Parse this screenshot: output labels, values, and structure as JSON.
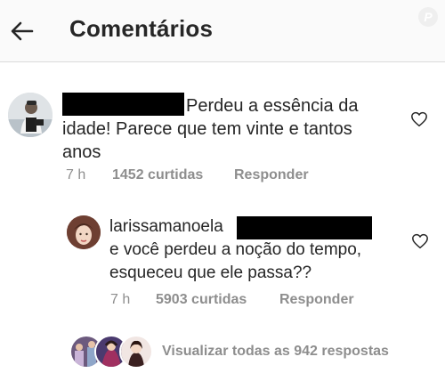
{
  "header": {
    "title": "Comentários",
    "back_icon": "arrow-left-icon",
    "watermark": "P"
  },
  "comment": {
    "text_line1": "Perdeu a essência da",
    "text_line2": "idade! Parece que tem vinte e tantos",
    "text_line3": "anos",
    "time": "7 h",
    "likes": "1452 curtidas",
    "reply_label": "Responder"
  },
  "reply": {
    "username": "larissamanoela",
    "text_line1": "e você perdeu a noção do tempo,",
    "text_line2": "esqueceu que ele passa??",
    "time": "7 h",
    "likes": "5903 curtidas",
    "reply_label": "Responder"
  },
  "replies_link": {
    "label": "Visualizar todas as 942 respostas"
  },
  "colors": {
    "text": "#262626",
    "meta": "#8e8e8e",
    "header_bg": "#fafafa",
    "border": "#dbdbdb"
  }
}
